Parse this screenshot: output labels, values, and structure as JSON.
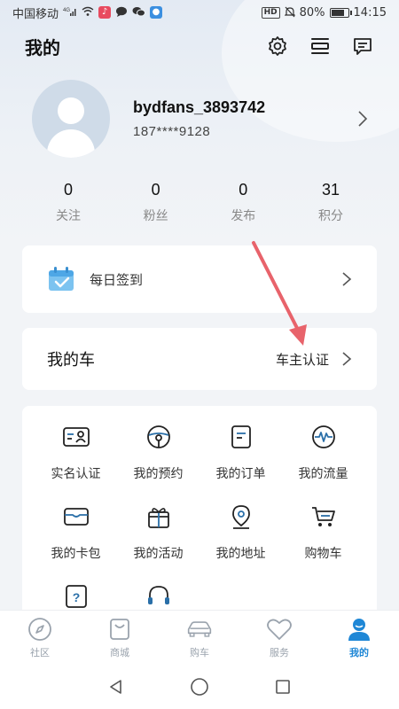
{
  "status_bar": {
    "carrier": "中国移动",
    "signal_text": "4G",
    "battery_percent": "80%",
    "time": "14:15",
    "hd_label": "HD"
  },
  "header": {
    "title": "我的",
    "icons": [
      "gear-icon",
      "list-icon",
      "message-icon"
    ]
  },
  "profile": {
    "username": "bydfans_3893742",
    "phone": "187****9128"
  },
  "stats": [
    {
      "value": "0",
      "label": "关注"
    },
    {
      "value": "0",
      "label": "粉丝"
    },
    {
      "value": "0",
      "label": "发布"
    },
    {
      "value": "31",
      "label": "积分"
    }
  ],
  "checkin": {
    "label": "每日签到"
  },
  "my_car": {
    "title": "我的车",
    "action": "车主认证"
  },
  "services": [
    {
      "label": "实名认证",
      "icon": "id-card-icon"
    },
    {
      "label": "我的预约",
      "icon": "steering-wheel-icon"
    },
    {
      "label": "我的订单",
      "icon": "order-icon"
    },
    {
      "label": "我的流量",
      "icon": "data-flow-icon"
    },
    {
      "label": "我的卡包",
      "icon": "wallet-icon"
    },
    {
      "label": "我的活动",
      "icon": "gift-icon"
    },
    {
      "label": "我的地址",
      "icon": "location-icon"
    },
    {
      "label": "购物车",
      "icon": "cart-icon"
    }
  ],
  "tabs": [
    {
      "label": "社区",
      "icon": "compass-icon",
      "active": false
    },
    {
      "label": "商城",
      "icon": "shop-bag-icon",
      "active": false
    },
    {
      "label": "购车",
      "icon": "car-icon",
      "active": false
    },
    {
      "label": "服务",
      "icon": "heart-icon",
      "active": false
    },
    {
      "label": "我的",
      "icon": "user-icon",
      "active": true
    }
  ],
  "colors": {
    "accent": "#1f87d6",
    "annotation": "#e8636b",
    "icon_blue": "#2a6fa8"
  }
}
